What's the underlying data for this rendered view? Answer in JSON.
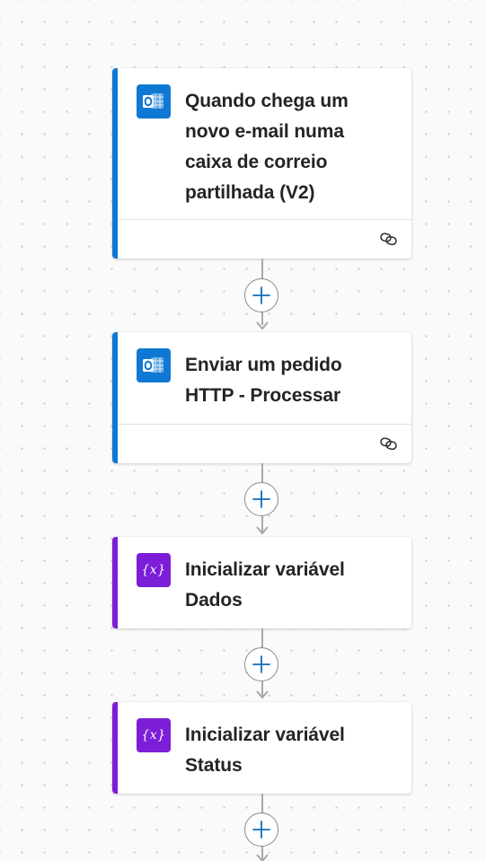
{
  "colors": {
    "outlook_accent": "#0f78d4",
    "variable_accent": "#7c1ed8",
    "add_button_plus": "#0f6cbd"
  },
  "steps": [
    {
      "title": "Quando chega um novo e-mail numa caixa de correio partilhada (V2)",
      "icon": "outlook-icon",
      "has_footer_link": true
    },
    {
      "title": "Enviar um pedido HTTP - Processar",
      "icon": "outlook-icon",
      "has_footer_link": true
    },
    {
      "title": "Inicializar variável Dados",
      "icon": "variable-icon",
      "icon_text": "{x}"
    },
    {
      "title": "Inicializar variável Status",
      "icon": "variable-icon",
      "icon_text": "{x}"
    }
  ],
  "connector_icons": {
    "add": "plus-icon",
    "link": "link-icon"
  }
}
